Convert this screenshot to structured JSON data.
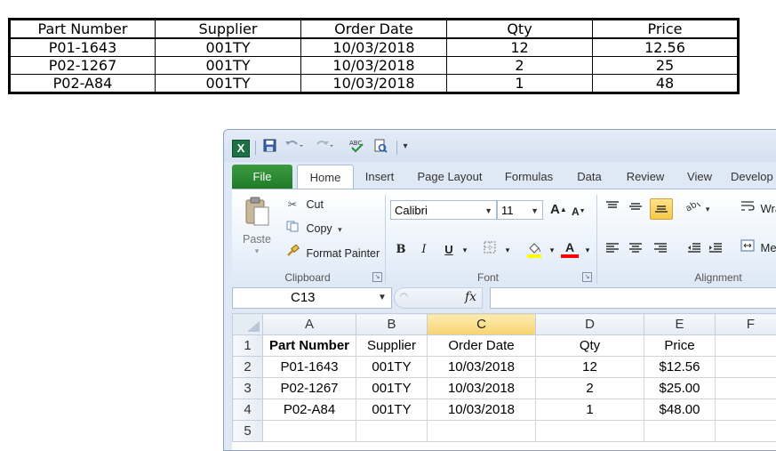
{
  "doc_table": {
    "headers": [
      "Part Number",
      "Supplier",
      "Order Date",
      "Qty",
      "Price"
    ],
    "rows": [
      [
        "P01-1643",
        "001TY",
        "10/03/2018",
        "12",
        "12.56"
      ],
      [
        "P02-1267",
        "001TY",
        "10/03/2018",
        "2",
        "25"
      ],
      [
        "P02-A84",
        "001TY",
        "10/03/2018",
        "1",
        "48"
      ]
    ]
  },
  "excel": {
    "qat": {
      "logo": "X",
      "undo_icon": "undo-icon",
      "redo_icon": "redo-icon"
    },
    "tabs": [
      "File",
      "Home",
      "Insert",
      "Page Layout",
      "Formulas",
      "Data",
      "Review",
      "View",
      "Develop"
    ],
    "clipboard": {
      "paste": "Paste",
      "cut": "Cut",
      "copy": "Copy",
      "format_painter": "Format Painter",
      "label": "Clipboard"
    },
    "font": {
      "name": "Calibri",
      "size": "11",
      "grow": "A",
      "shrink": "A",
      "bold": "B",
      "italic": "I",
      "underline": "U",
      "font_color_letter": "A",
      "label": "Font"
    },
    "alignment": {
      "wrap": "Wra",
      "merge": "Me",
      "label": "Alignment"
    },
    "formula_bar": {
      "name_box": "C13",
      "fx": "fx",
      "formula": ""
    },
    "grid": {
      "columns": [
        "A",
        "B",
        "C",
        "D",
        "E",
        "F"
      ],
      "selected_column": "C",
      "rows": [
        {
          "num": "1",
          "cells": [
            "Part Number",
            "Supplier",
            "Order Date",
            "Qty",
            "Price",
            ""
          ]
        },
        {
          "num": "2",
          "cells": [
            "P01-1643",
            "001TY",
            "10/03/2018",
            "12",
            "$12.56",
            ""
          ]
        },
        {
          "num": "3",
          "cells": [
            "P02-1267",
            "001TY",
            "10/03/2018",
            "2",
            "$25.00",
            ""
          ]
        },
        {
          "num": "4",
          "cells": [
            "P02-A84",
            "001TY",
            "10/03/2018",
            "1",
            "$48.00",
            ""
          ]
        },
        {
          "num": "5",
          "cells": [
            "",
            "",
            "",
            "",
            "",
            ""
          ]
        }
      ]
    },
    "colors": {
      "file_tab": "#1f7b29",
      "highlight": "#ffff00",
      "font_color": "#ff0000",
      "selected_header": "#f8d46f"
    }
  }
}
